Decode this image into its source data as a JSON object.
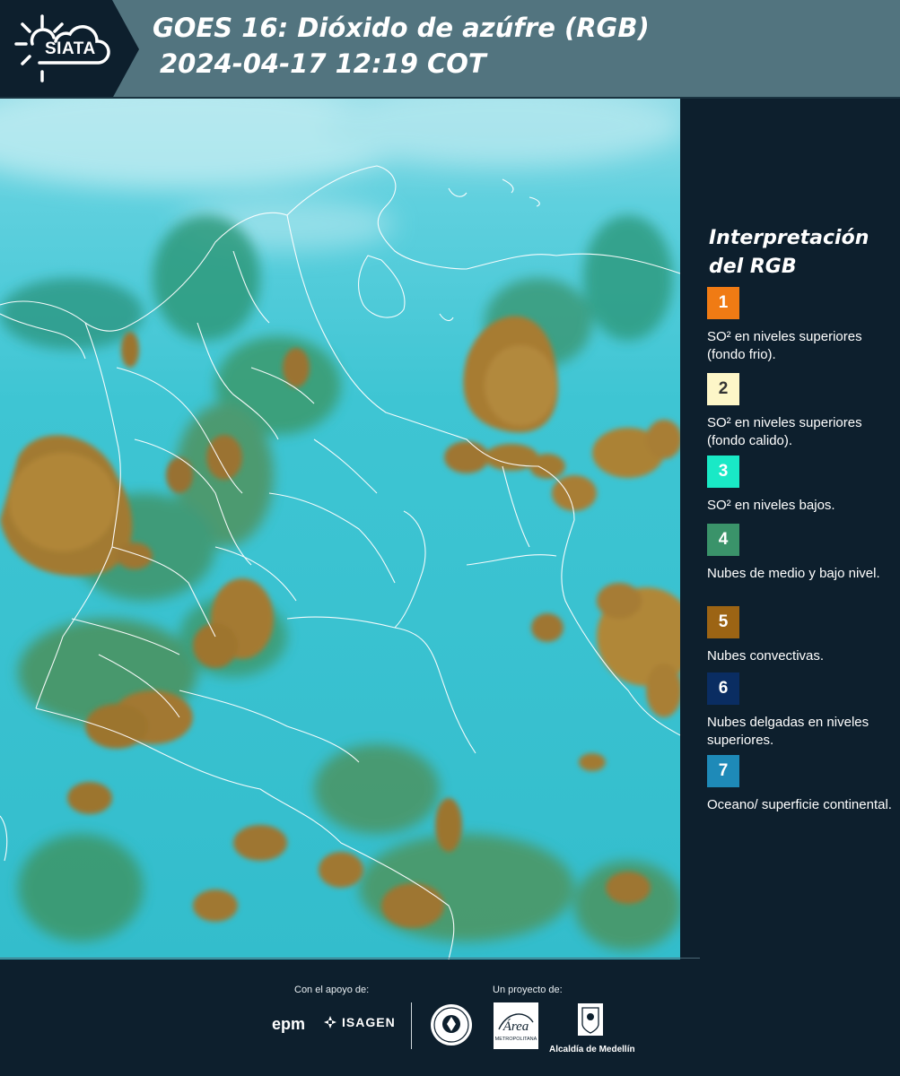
{
  "header": {
    "logo_text": "SIATA",
    "title_line1": "GOES 16: Dióxido de azúfre (RGB)",
    "title_line2": "2024-04-17 12:19 COT"
  },
  "legend": {
    "title": "Interpretación del RGB",
    "items": [
      {
        "number": "1",
        "label": "SO² en niveles superiores (fondo frio).",
        "color": "#f07b14",
        "text_color": "#ffffff"
      },
      {
        "number": "2",
        "label": "SO² en niveles superiores (fondo calido).",
        "color": "#fdf6c8",
        "text_color": "#333333"
      },
      {
        "number": "3",
        "label": "SO² en niveles bajos.",
        "color": "#19e9c6",
        "text_color": "#ffffff"
      },
      {
        "number": "4",
        "label": "Nubes de medio y bajo nivel.",
        "color": "#3a936a",
        "text_color": "#ffffff"
      },
      {
        "number": "5",
        "label": "Nubes convectivas.",
        "color": "#9c6414",
        "text_color": "#ffffff"
      },
      {
        "number": "6",
        "label": "Nubes delgadas en niveles superiores.",
        "color": "#0a2d62",
        "text_color": "#ffffff"
      },
      {
        "number": "7",
        "label": "Oceano/ superficie continental.",
        "color": "#1e8ab8",
        "text_color": "#ffffff"
      }
    ]
  },
  "footer": {
    "support_label": "Con el apoyo de:",
    "project_label": "Un proyecto de:",
    "sponsor_epm": "epm",
    "sponsor_isagen": "ISAGEN",
    "partner_area": "Área",
    "partner_area_sub": "METROPOLITANA",
    "partner_alcaldia": "Alcaldía de Medellín"
  },
  "colors": {
    "background": "#0d1f2d",
    "header_band": "#52747f",
    "map_base": "#38bfd0",
    "cloud_convective": "#a27a32",
    "border_lines": "#ffffff"
  }
}
